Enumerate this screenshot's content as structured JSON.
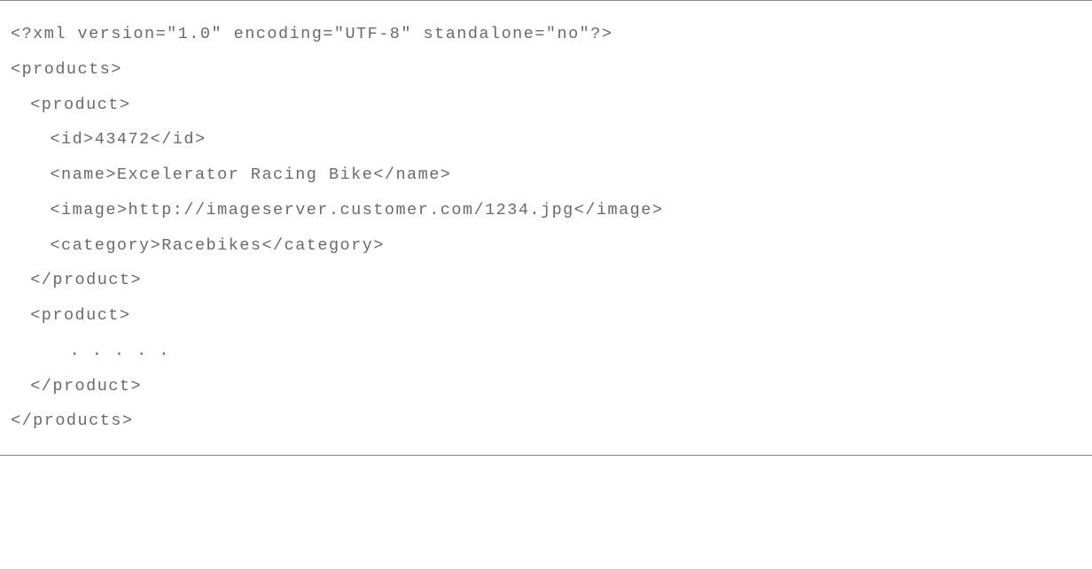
{
  "lines": [
    {
      "indent": 0,
      "text": "<?xml version=\"1.0\" encoding=\"UTF-8\" standalone=\"no\"?>"
    },
    {
      "indent": 0,
      "text": "<products>"
    },
    {
      "indent": 1,
      "text": "<product>"
    },
    {
      "indent": 2,
      "text": "<id>43472</id>"
    },
    {
      "indent": 2,
      "text": "<name>Excelerator Racing Bike</name>"
    },
    {
      "indent": 2,
      "text": "<image>http://imageserver.customer.com/1234.jpg</image>"
    },
    {
      "indent": 2,
      "text": "<category>Racebikes</category>"
    },
    {
      "indent": 1,
      "text": "</product>"
    },
    {
      "indent": 1,
      "text": "<product>"
    },
    {
      "indent": 3,
      "text": ". . . . ."
    },
    {
      "indent": 1,
      "text": "</product>"
    },
    {
      "indent": 0,
      "text": "</products>"
    }
  ]
}
